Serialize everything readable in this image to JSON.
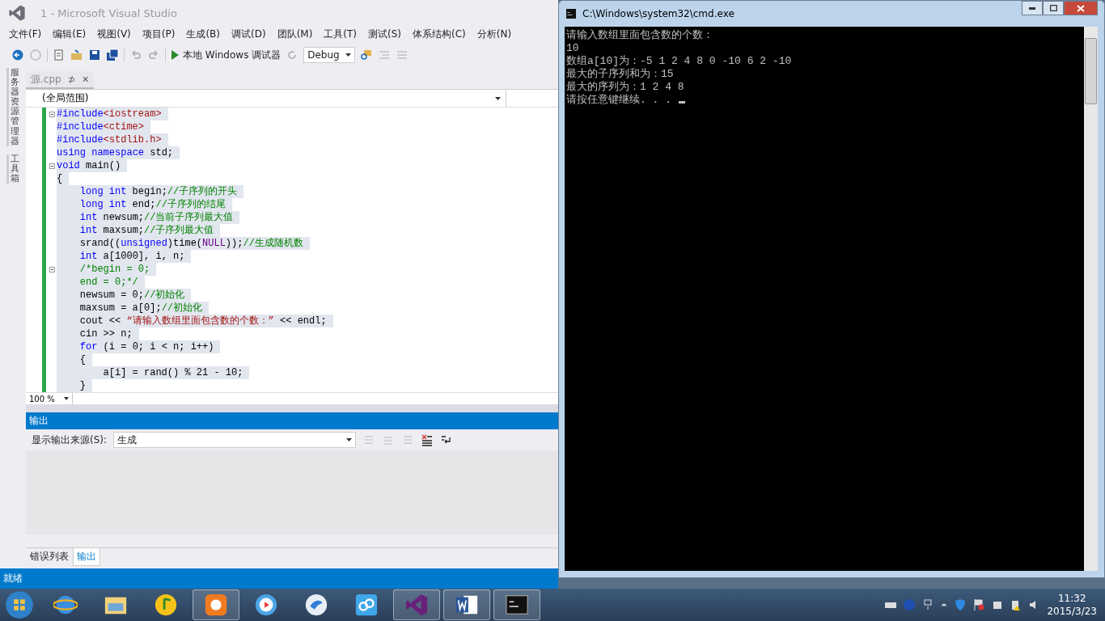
{
  "vs_window": {
    "title": "1 - Microsoft Visual Studio",
    "menu": [
      "文件(F)",
      "编辑(E)",
      "视图(V)",
      "项目(P)",
      "生成(B)",
      "调试(D)",
      "团队(M)",
      "工具(T)",
      "测试(S)",
      "体系结构(C)",
      "分析(N)"
    ],
    "toolbar": {
      "debugger_label": "本地 Windows 调试器",
      "config": "Debug"
    },
    "side_tabs": [
      "服务器资源管理器",
      "工具箱"
    ],
    "doc_tab": {
      "label": "源.cpp",
      "pin": "⊅",
      "close": "✕"
    },
    "scope": "(全局范围)",
    "code_lines": [
      {
        "fold": true,
        "tokens": [
          {
            "kind": "keyword",
            "text": "#include"
          },
          {
            "kind": "string",
            "text": "<iostream>"
          }
        ]
      },
      {
        "fold": false,
        "tokens": [
          {
            "kind": "keyword",
            "text": "#include"
          },
          {
            "kind": "string",
            "text": "<ctime>"
          }
        ]
      },
      {
        "fold": false,
        "tokens": [
          {
            "kind": "keyword",
            "text": "#include"
          },
          {
            "kind": "string",
            "text": "<stdlib.h>"
          }
        ]
      },
      {
        "fold": false,
        "tokens": [
          {
            "kind": "keyword",
            "text": "using"
          },
          {
            "kind": "keyword",
            "text": " namespace"
          },
          {
            "kind": "plain",
            "text": " std;"
          }
        ]
      },
      {
        "fold": true,
        "tokens": [
          {
            "kind": "keyword",
            "text": "void"
          },
          {
            "kind": "plain",
            "text": " main()"
          }
        ]
      },
      {
        "fold": false,
        "tokens": [
          {
            "kind": "plain",
            "text": "{"
          }
        ]
      },
      {
        "fold": false,
        "tokens": [
          {
            "kind": "keyword",
            "text": "    long"
          },
          {
            "kind": "keyword",
            "text": " int"
          },
          {
            "kind": "plain",
            "text": " begin;"
          },
          {
            "kind": "comment",
            "text": "//子序列的开头"
          }
        ]
      },
      {
        "fold": false,
        "tokens": [
          {
            "kind": "keyword",
            "text": "    long"
          },
          {
            "kind": "keyword",
            "text": " int"
          },
          {
            "kind": "plain",
            "text": " end;"
          },
          {
            "kind": "comment",
            "text": "//子序列的结尾"
          }
        ]
      },
      {
        "fold": false,
        "tokens": [
          {
            "kind": "keyword",
            "text": "    int"
          },
          {
            "kind": "plain",
            "text": " newsum;"
          },
          {
            "kind": "comment",
            "text": "//当前子序列最大值"
          }
        ]
      },
      {
        "fold": false,
        "tokens": [
          {
            "kind": "keyword",
            "text": "    int"
          },
          {
            "kind": "plain",
            "text": " maxsum;"
          },
          {
            "kind": "comment",
            "text": "//子序列最大值"
          }
        ]
      },
      {
        "fold": false,
        "tokens": [
          {
            "kind": "plain",
            "text": "    srand(("
          },
          {
            "kind": "keyword",
            "text": "unsigned"
          },
          {
            "kind": "plain",
            "text": ")time("
          },
          {
            "kind": "macro",
            "text": "NULL"
          },
          {
            "kind": "plain",
            "text": "));"
          },
          {
            "kind": "comment",
            "text": "//生成随机数"
          }
        ]
      },
      {
        "fold": false,
        "tokens": [
          {
            "kind": "keyword",
            "text": "    int"
          },
          {
            "kind": "plain",
            "text": " a[1000], i, n;"
          }
        ]
      },
      {
        "fold": true,
        "tokens": [
          {
            "kind": "comment",
            "text": "    /*begin = 0;"
          }
        ]
      },
      {
        "fold": false,
        "tokens": [
          {
            "kind": "comment",
            "text": "    end = 0;*/"
          }
        ]
      },
      {
        "fold": false,
        "tokens": [
          {
            "kind": "plain",
            "text": "    newsum = 0;"
          },
          {
            "kind": "comment",
            "text": "//初始化"
          }
        ]
      },
      {
        "fold": false,
        "tokens": [
          {
            "kind": "plain",
            "text": "    maxsum = a[0];"
          },
          {
            "kind": "comment",
            "text": "//初始化"
          }
        ]
      },
      {
        "fold": false,
        "tokens": [
          {
            "kind": "plain",
            "text": "    cout << "
          },
          {
            "kind": "string",
            "text": "“请输入数组里面包含数的个数：”"
          },
          {
            "kind": "plain",
            "text": " << endl;"
          }
        ]
      },
      {
        "fold": false,
        "tokens": [
          {
            "kind": "plain",
            "text": "    cin >> n;"
          }
        ]
      },
      {
        "fold": false,
        "tokens": [
          {
            "kind": "keyword",
            "text": "    for"
          },
          {
            "kind": "plain",
            "text": " (i = 0; i < n; i++)"
          }
        ]
      },
      {
        "fold": false,
        "tokens": [
          {
            "kind": "plain",
            "text": "    {"
          }
        ]
      },
      {
        "fold": false,
        "tokens": [
          {
            "kind": "plain",
            "text": "        a[i] = rand() % 21 - 10;"
          }
        ]
      },
      {
        "fold": false,
        "tokens": [
          {
            "kind": "plain",
            "text": "    }"
          }
        ]
      }
    ],
    "zoom": "100 %",
    "output": {
      "title": "输出",
      "source_label": "显示输出来源(S):",
      "source": "生成"
    },
    "bottom_tabs": [
      {
        "label": "错误列表",
        "selected": false
      },
      {
        "label": "输出",
        "selected": true
      }
    ],
    "status": "就绪"
  },
  "cmd_window": {
    "title": "C:\\Windows\\system32\\cmd.exe",
    "lines": [
      "请输入数组里面包含数的个数：",
      "10",
      "数组a[10]为：-5 1 2 4 8 0 -10 6 2 -10",
      "最大的子序列和为：15",
      "最大的序列为：1 2 4 8",
      "请按任意键继续. . . "
    ]
  },
  "taskbar": {
    "apps": [
      {
        "kind": "ie",
        "running": false
      },
      {
        "kind": "folder",
        "running": false
      },
      {
        "kind": "music",
        "running": false
      },
      {
        "kind": "browser",
        "running": true
      },
      {
        "kind": "video",
        "running": false
      },
      {
        "kind": "chat",
        "running": false
      },
      {
        "kind": "cloud",
        "running": false
      },
      {
        "kind": "vs",
        "running": true
      },
      {
        "kind": "word",
        "running": true
      },
      {
        "kind": "cmd",
        "running": true
      }
    ],
    "time": "11:32",
    "date": "2015/3/23"
  }
}
